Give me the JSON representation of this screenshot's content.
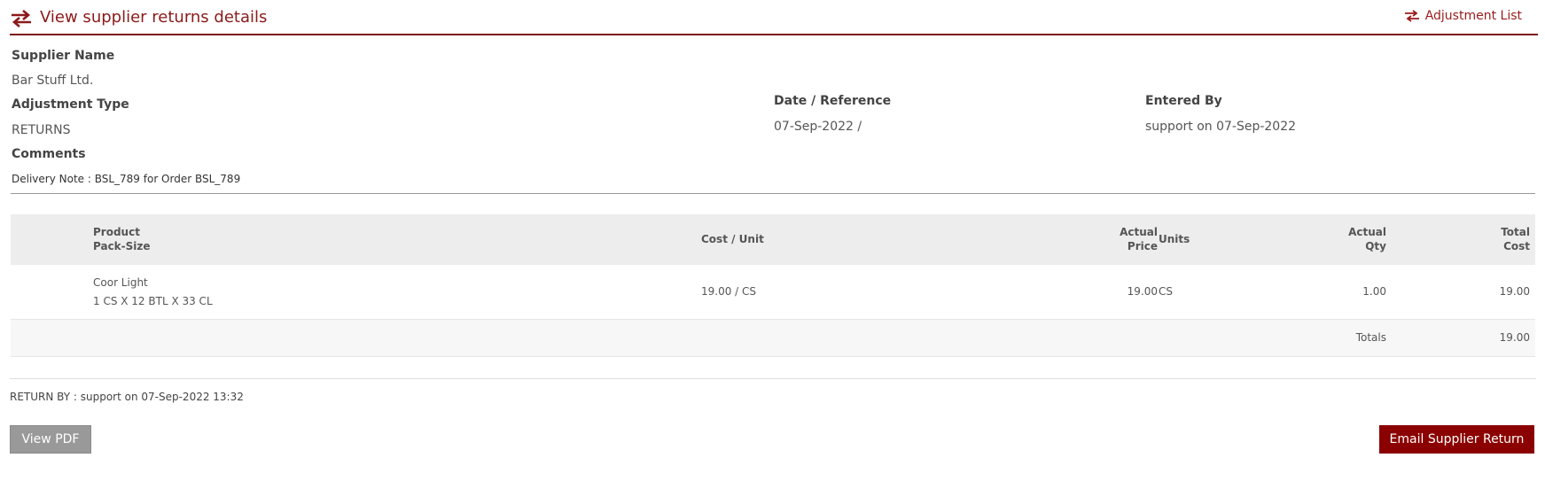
{
  "header": {
    "title": "View supplier returns details",
    "title_icon": "swap-arrows-icon",
    "adjustment_link": "Adjustment List",
    "accent_color": "#8b1a1a"
  },
  "details": {
    "supplier_name_label": "Supplier Name",
    "supplier_name": "Bar Stuff Ltd.",
    "adjustment_type_label": "Adjustment Type",
    "adjustment_type": "RETURNS",
    "comments_label": "Comments",
    "comments": "Delivery Note : BSL_789 for Order BSL_789",
    "date_reference_label": "Date / Reference",
    "date_reference": "07-Sep-2022 /",
    "entered_by_label": "Entered By",
    "entered_by": "support on 07-Sep-2022"
  },
  "table": {
    "headers": {
      "product": "Product",
      "pack_size": "Pack-Size",
      "cost_unit": "Cost / Unit",
      "actual_price_1": "Actual",
      "actual_price_2": "Price",
      "units": "Units",
      "actual_qty_1": "Actual",
      "actual_qty_2": "Qty",
      "total_cost_1": "Total",
      "total_cost_2": "Cost"
    },
    "rows": [
      {
        "product": "Coor Light",
        "pack_size": "1 CS X 12 BTL X 33 CL",
        "cost_unit": "19.00 / CS",
        "actual_price": "19.00",
        "units": "CS",
        "actual_qty": "1.00",
        "total_cost": "19.00"
      }
    ],
    "totals_label": "Totals",
    "totals_value": "19.00"
  },
  "footer": {
    "return_by": "RETURN BY : support on 07-Sep-2022 13:32",
    "view_pdf_label": "View PDF",
    "email_label": "Email Supplier Return",
    "email_color": "#8b0000"
  }
}
